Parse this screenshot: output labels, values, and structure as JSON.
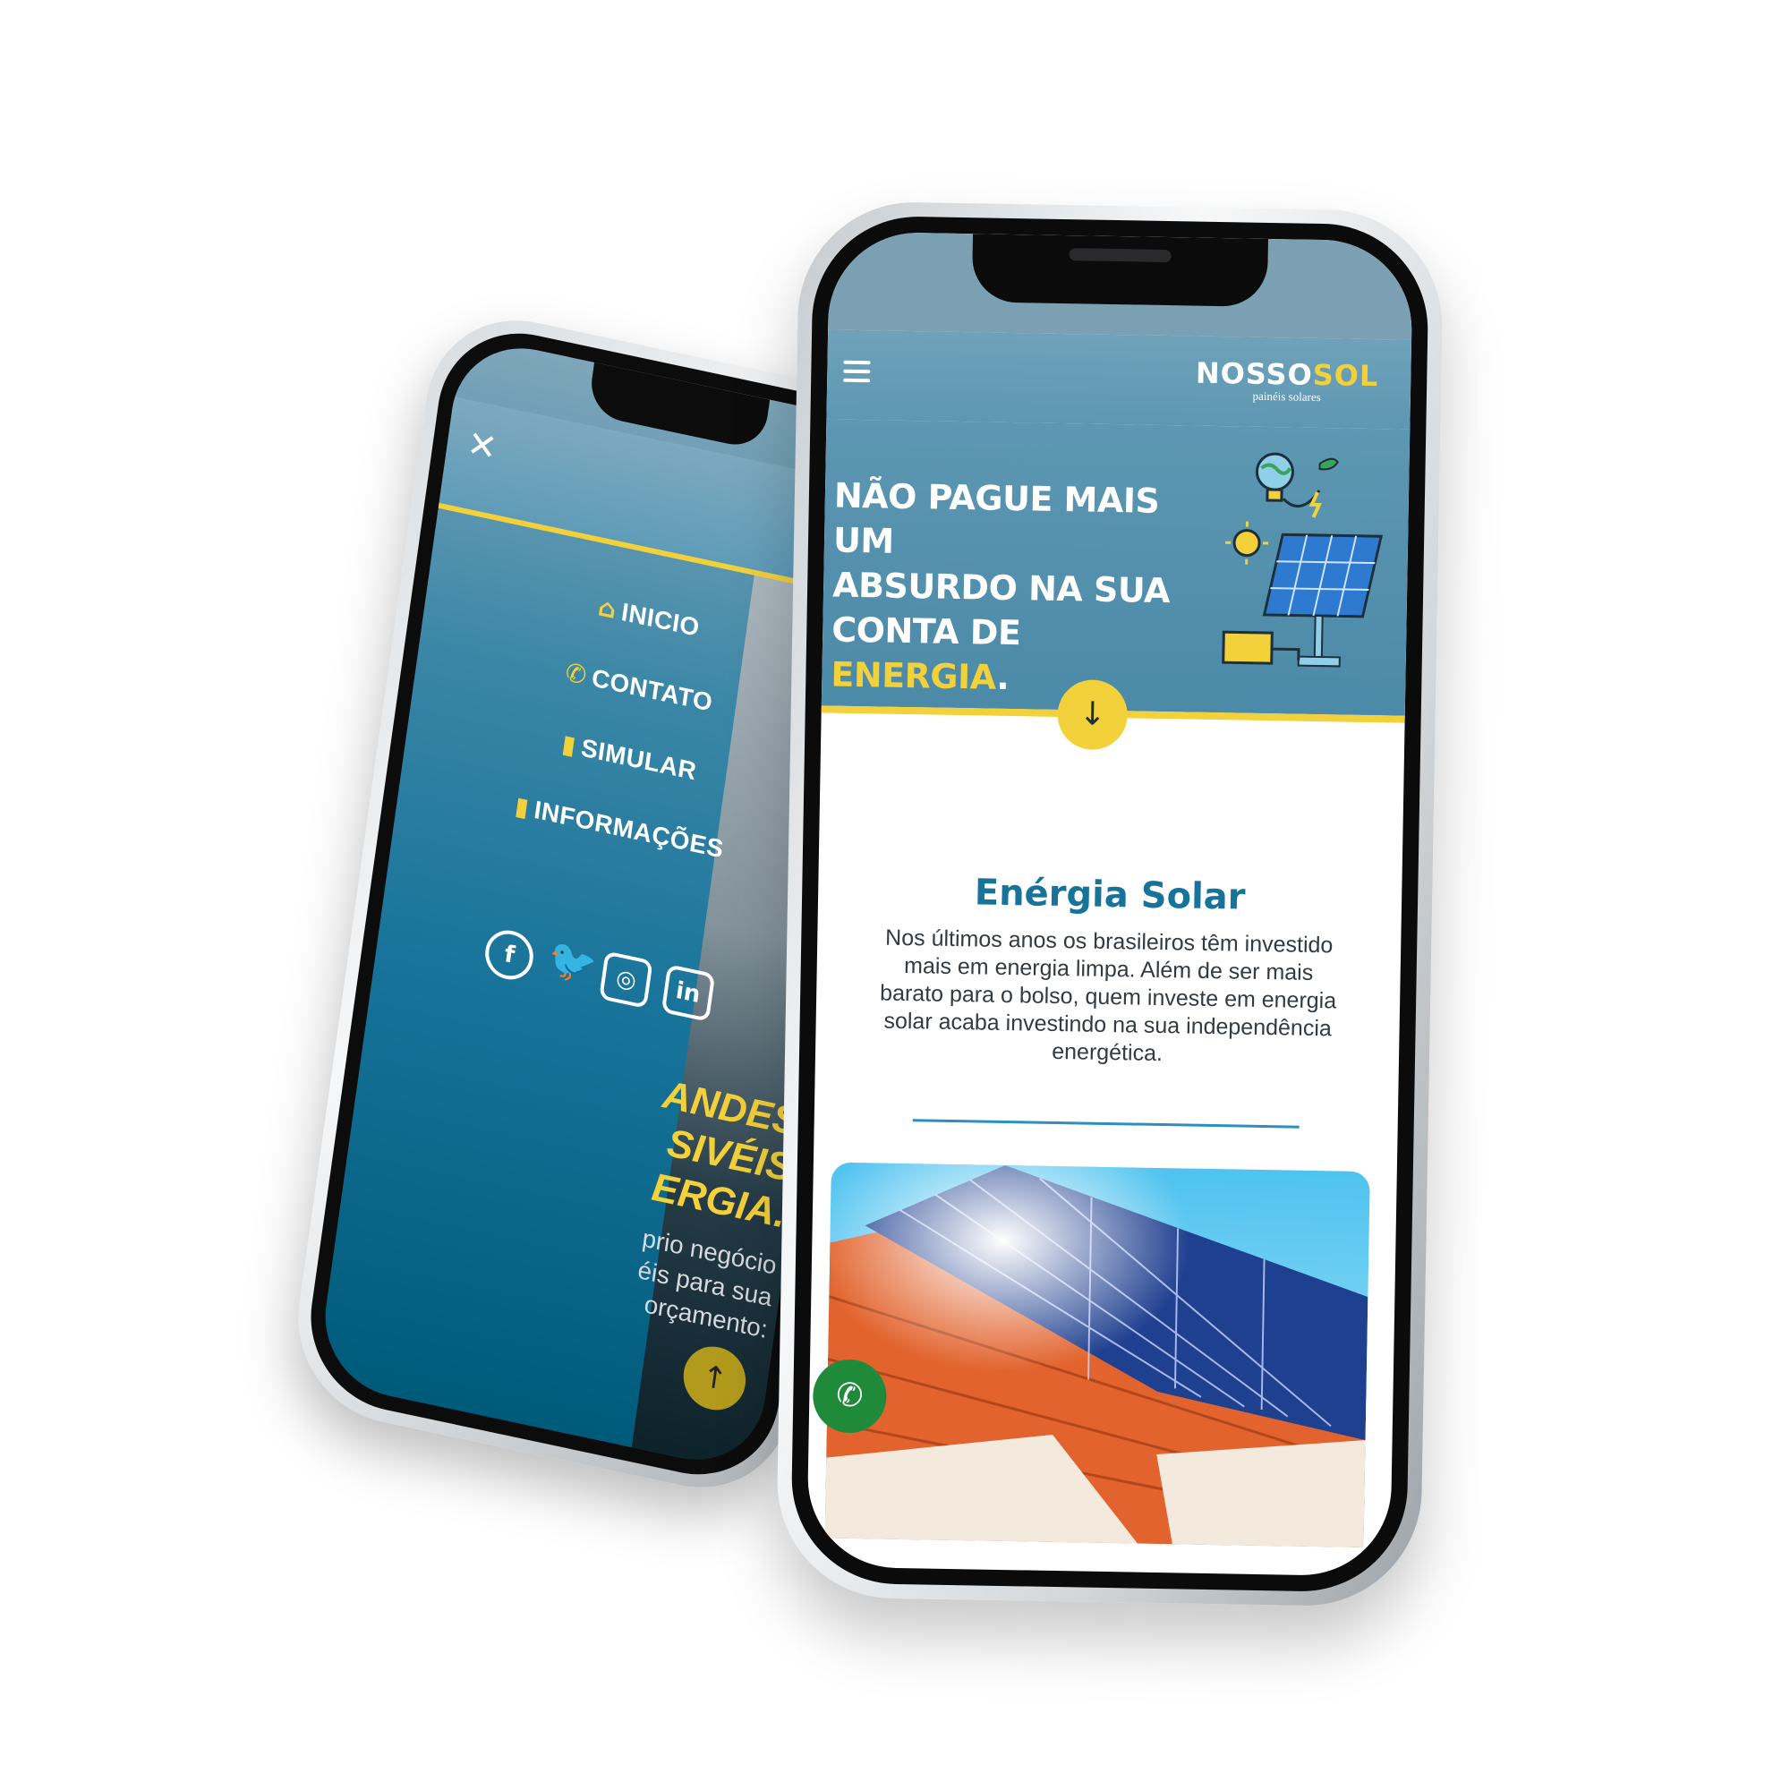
{
  "left_phone": {
    "menu": [
      {
        "icon": "home-icon",
        "glyph": "⌂",
        "label": "INICIO"
      },
      {
        "icon": "phone-icon",
        "glyph": "✆",
        "label": "CONTATO"
      },
      {
        "icon": "bar-chart-icon",
        "glyph": "▮",
        "label": "SIMULAR"
      },
      {
        "icon": "bar-chart-icon",
        "glyph": "▮",
        "label": "INFORMAÇÕES"
      }
    ],
    "social": [
      {
        "icon": "facebook-icon",
        "glyph": "f"
      },
      {
        "icon": "twitter-icon",
        "glyph": "🐦"
      },
      {
        "icon": "instagram-icon",
        "glyph": "◎"
      },
      {
        "icon": "linkedin-icon",
        "glyph": "in"
      }
    ],
    "bg_title": "ANDES\nSIVÉIS\nERGIA.",
    "bg_text": "prio negócio\néis para sua\norçamento:",
    "up_glyph": "↑"
  },
  "right_phone": {
    "brand": {
      "part1": "NOSSO",
      "part2": "SOL",
      "subtitle": "painéis solares"
    },
    "hero": {
      "line1": "NÃO PAGUE MAIS UM",
      "line2": "ABSURDO NA SUA",
      "line3_a": "CONTA DE ",
      "line3_highlight": "ENERGIA",
      "line3_b": "."
    },
    "down_glyph": "↓",
    "section": {
      "title": "Enérgia Solar",
      "text": "Nos últimos anos os brasileiros têm investido mais em energia limpa. Além de ser mais barato para o bolso, quem investe em energia solar acaba investindo na sua independência energética."
    },
    "whatsapp_glyph": "✆"
  },
  "colors": {
    "accent_yellow": "#f2d13a",
    "primary_blue": "#17739a",
    "whatsapp_green": "#1f8a3a"
  }
}
